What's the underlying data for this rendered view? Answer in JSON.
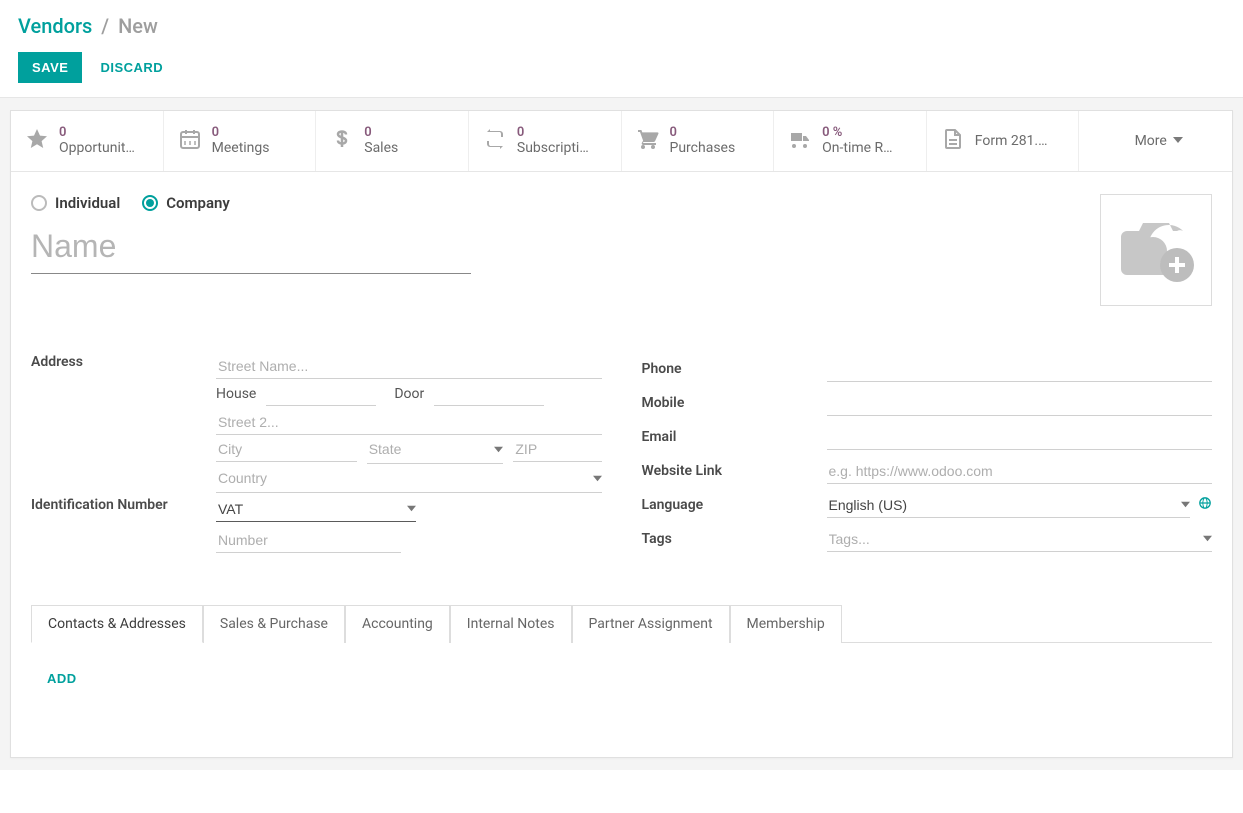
{
  "breadcrumb": {
    "root": "Vendors",
    "current": "New"
  },
  "actions": {
    "save": "SAVE",
    "discard": "DISCARD"
  },
  "stats": {
    "opportunities": {
      "count": "0",
      "label": "Opportunit…"
    },
    "meetings": {
      "count": "0",
      "label": "Meetings"
    },
    "sales": {
      "count": "0",
      "label": "Sales"
    },
    "subscriptions": {
      "count": "0",
      "label": "Subscripti…"
    },
    "purchases": {
      "count": "0",
      "label": "Purchases"
    },
    "ontime": {
      "count": "0 %",
      "label": "On-time R…"
    },
    "form281": {
      "label": "Form 281.…"
    },
    "more": "More"
  },
  "type_radio": {
    "individual": "Individual",
    "company": "Company",
    "selected": "company"
  },
  "name_placeholder": "Name",
  "labels": {
    "address": "Address",
    "id_number": "Identification Number",
    "phone": "Phone",
    "mobile": "Mobile",
    "email": "Email",
    "website": "Website Link",
    "language": "Language",
    "tags": "Tags"
  },
  "address": {
    "street_ph": "Street Name...",
    "house_label": "House",
    "door_label": "Door",
    "street2_ph": "Street 2...",
    "city_ph": "City",
    "state_ph": "State",
    "zip_ph": "ZIP",
    "country_ph": "Country"
  },
  "id_type_value": "VAT",
  "id_number_ph": "Number",
  "website_ph": "e.g. https://www.odoo.com",
  "language_value": "English (US)",
  "tags_ph": "Tags...",
  "tabs": {
    "contacts": "Contacts & Addresses",
    "sales_purchase": "Sales & Purchase",
    "accounting": "Accounting",
    "internal_notes": "Internal Notes",
    "partner": "Partner Assignment",
    "membership": "Membership"
  },
  "tab_content": {
    "add": "ADD"
  }
}
